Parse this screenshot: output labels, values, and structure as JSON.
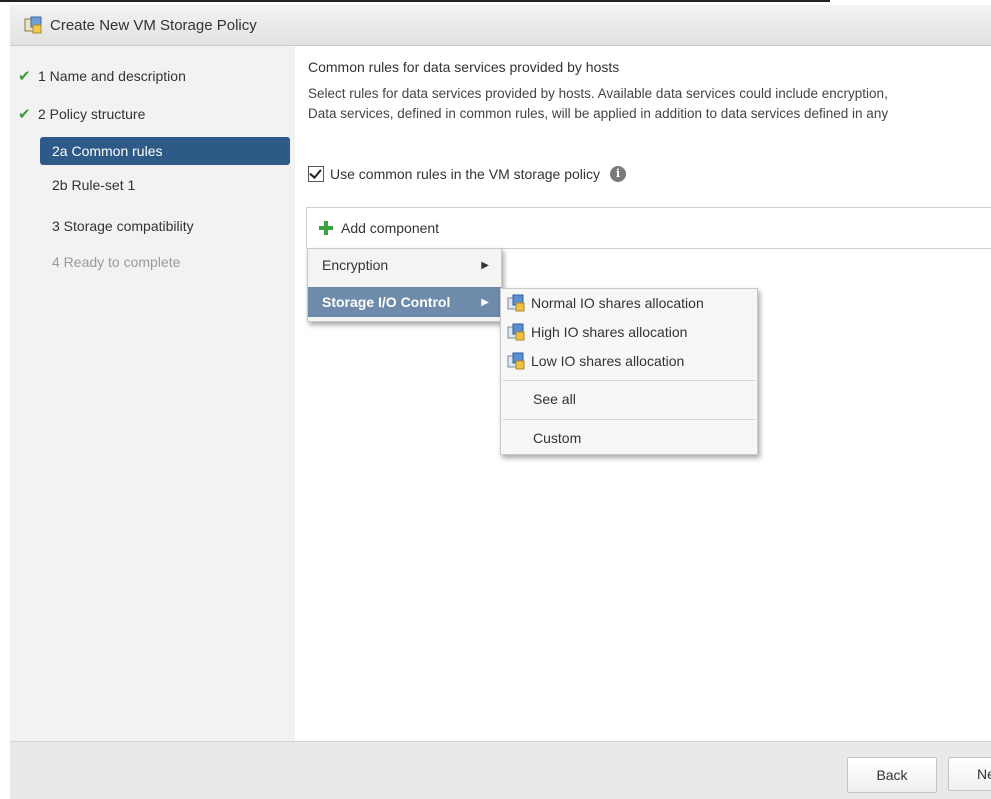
{
  "window": {
    "title": "Create New VM Storage Policy"
  },
  "steps": [
    {
      "label": "1 Name and description",
      "completed": true
    },
    {
      "label": "2 Policy structure",
      "completed": true
    },
    {
      "label": "2a Common rules",
      "active": true
    },
    {
      "label": "2b Rule-set 1"
    },
    {
      "label": "3 Storage compatibility"
    },
    {
      "label": "4 Ready to complete",
      "disabled": true
    }
  ],
  "main": {
    "title": "Common rules for data services provided by hosts",
    "description_line1": "Select rules for data services provided by hosts. Available data services could include encryption,",
    "description_line2": "Data services, defined in common rules, will be applied in addition to data services defined in any",
    "use_common_rules_label": "Use common rules in the VM storage policy",
    "use_common_rules_checked": true,
    "add_component_label": "Add component"
  },
  "component_menu": {
    "items": [
      {
        "label": "Encryption"
      },
      {
        "label": "Storage I/O Control",
        "selected": true
      }
    ]
  },
  "submenu": {
    "items": [
      {
        "label": "Normal IO shares allocation",
        "icon": "policy-icon"
      },
      {
        "label": "High IO shares allocation",
        "icon": "policy-icon"
      },
      {
        "label": "Low IO shares allocation",
        "icon": "policy-icon"
      }
    ],
    "see_all": "See all",
    "custom": "Custom"
  },
  "footer": {
    "back_label": "Back",
    "next_label": "Ne"
  },
  "colors": {
    "active_step_bg": "#2d5a86",
    "selected_menu_bg": "#6f8bab",
    "check": "#3c9a3c",
    "plus": "#3ea23e"
  }
}
